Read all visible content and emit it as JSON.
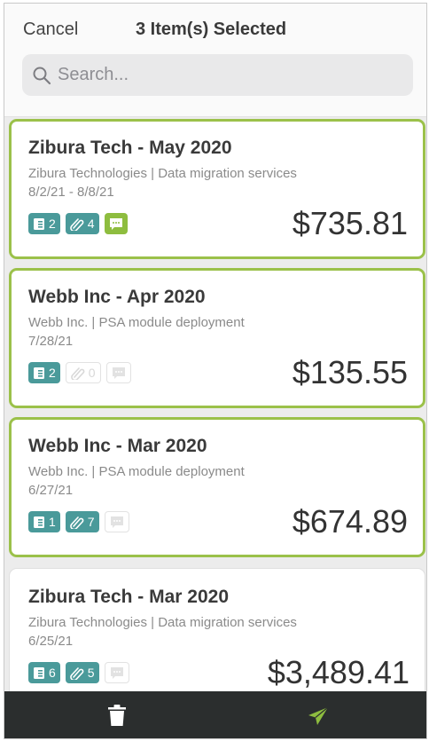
{
  "header": {
    "cancel_label": "Cancel",
    "title": "3 Item(s) Selected"
  },
  "search": {
    "placeholder": "Search..."
  },
  "cards": [
    {
      "title": "Zibura Tech - May 2020",
      "subtitle": "Zibura Technologies | Data migration services",
      "date": "8/2/21 - 8/8/21",
      "receipts": "2",
      "attachments": "4",
      "amount": "$735.81",
      "selected": true
    },
    {
      "title": "Webb Inc - Apr 2020",
      "subtitle": "Webb Inc. | PSA module deployment",
      "date": "7/28/21",
      "receipts": "2",
      "attachments": "0",
      "amount": "$135.55",
      "selected": true
    },
    {
      "title": "Webb Inc - Mar 2020",
      "subtitle": "Webb Inc. | PSA module deployment",
      "date": "6/27/21",
      "receipts": "1",
      "attachments": "7",
      "amount": "$674.89",
      "selected": true
    },
    {
      "title": "Zibura Tech - Mar 2020",
      "subtitle": "Zibura Technologies | Data migration services",
      "date": "6/25/21",
      "receipts": "6",
      "attachments": "5",
      "amount": "$3,489.41",
      "selected": false
    }
  ],
  "icons": {
    "search": "search-icon",
    "receipt": "receipt-icon",
    "attachment": "paperclip-icon",
    "comment": "comment-icon",
    "delete": "trash-icon",
    "submit": "send-icon"
  },
  "colors": {
    "selected_border": "#9bc14a",
    "badge_teal": "#4a9a9a",
    "badge_green": "#8ebd3f",
    "toolbar": "#2b2e2e",
    "send_icon": "#8ebd3f"
  }
}
